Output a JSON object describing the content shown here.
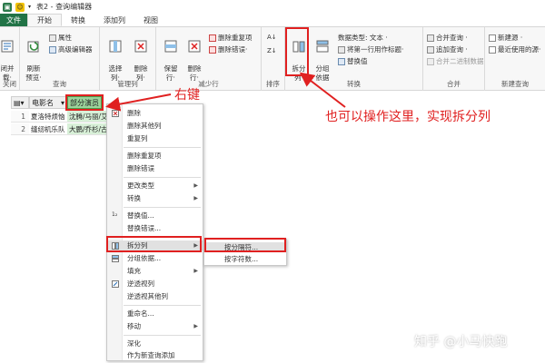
{
  "window": {
    "title": "表2 - 查询编辑器"
  },
  "tabs": [
    "文件",
    "开始",
    "转换",
    "添加列",
    "视图"
  ],
  "ribbon": {
    "close_group_label": "关闭",
    "close_button": "闭并\n载·",
    "query_group_label": "查询",
    "refresh_button": "刷新\n预览·",
    "properties_button": "属性",
    "advanced_editor_button": "高级编辑器",
    "manage_cols_group_label": "管理列",
    "choose_cols_button": "选择\n列·",
    "remove_cols_button": "删除\n列·",
    "reduce_rows_group_label": "减少行",
    "keep_rows_button": "保留\n行·",
    "remove_rows_button": "删除\n行·",
    "remove_duplicates_button": "删除重复项",
    "remove_errors_button": "删除错误·",
    "sort_group_label": "排序",
    "transform_group_label": "转换",
    "split_column_button": "拆分\n列·",
    "group_by_button": "分组\n依据",
    "data_type_label": "数据类型: 文本 ·",
    "first_row_header_button": "将第一行用作标题·",
    "replace_values_button": "替换值",
    "combine_group_label": "合并",
    "merge_queries_button": "合并查询 ·",
    "append_queries_button": "追加查询 ·",
    "merge_binaries_button": "合并二进制数据",
    "new_query_group_label": "新建查询",
    "new_source_button": "新建源 ·",
    "recent_sources_button": "最近使用的源·"
  },
  "grid": {
    "columns": [
      "电影名",
      "部分演员"
    ],
    "rows": [
      {
        "num": "1",
        "cells": [
          "夏洛特烦恼",
          "沈腾/马丽/艾"
        ]
      },
      {
        "num": "2",
        "cells": [
          "缝纫机乐队",
          "大鹏/乔杉/古"
        ]
      }
    ]
  },
  "context_menu": {
    "items": [
      "删除",
      "删除其他列",
      "重复列",
      "删除重复项",
      "删除错误",
      "更改类型",
      "转换",
      "替换值...",
      "替换错误...",
      "拆分列",
      "分组依据...",
      "填充",
      "逆透视列",
      "逆透视其他列",
      "重命名...",
      "移动",
      "深化",
      "作为新查询添加"
    ]
  },
  "submenu": {
    "items": [
      "按分隔符...",
      "按字符数..."
    ]
  },
  "annotations": {
    "right_click": "右键",
    "ribbon_hint": "也可以操作这里，实现拆分列"
  },
  "watermark": "知乎 @小马快跑",
  "colors": {
    "accent": "#217346",
    "annotation": "#e02020",
    "selected_col": "#9bd39b"
  }
}
